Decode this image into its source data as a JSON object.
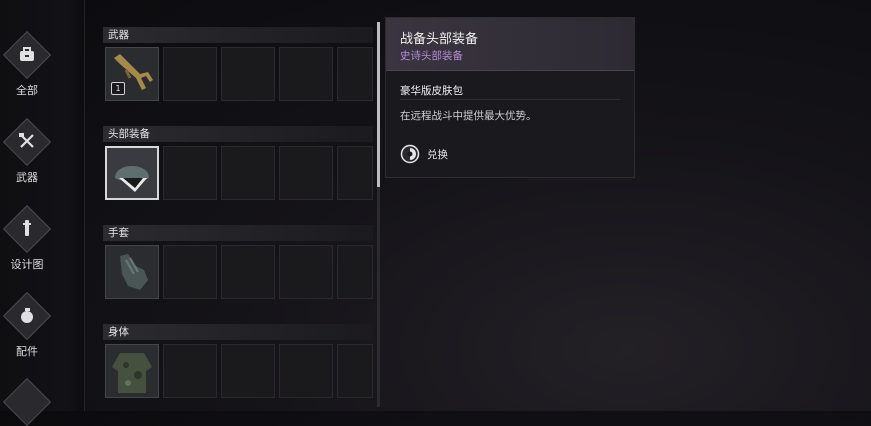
{
  "nav": {
    "items": [
      {
        "label": "全部",
        "icon": "bag-icon"
      },
      {
        "label": "武器",
        "icon": "crossed-weapons-icon"
      },
      {
        "label": "设计图",
        "icon": "blueprint-icon"
      },
      {
        "label": "配件",
        "icon": "grenade-icon"
      }
    ]
  },
  "categories": [
    {
      "label": "武器"
    },
    {
      "label": "头部装备"
    },
    {
      "label": "手套"
    },
    {
      "label": "身体"
    }
  ],
  "weapon_slot": {
    "count": "1"
  },
  "detail": {
    "title": "战备头部装备",
    "rarity": "史诗头部装备",
    "skin_pack": "豪华版皮肤包",
    "description": "在远程战斗中提供最大优势。",
    "redeem_label": "兑换"
  },
  "colors": {
    "rarity": "#b68ad8",
    "selected_border": "#d8d8d8"
  }
}
